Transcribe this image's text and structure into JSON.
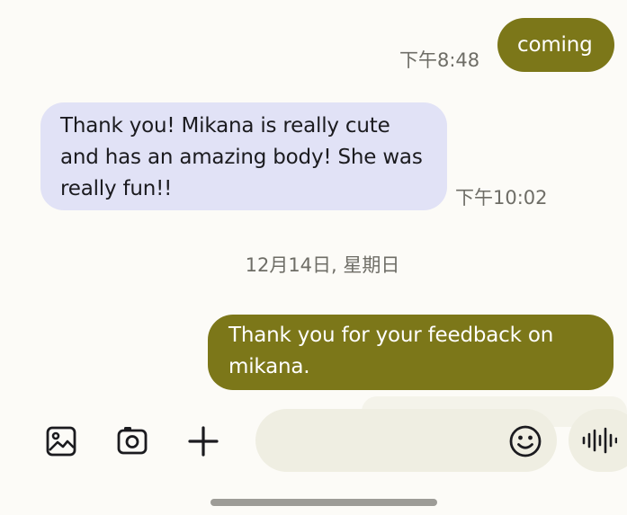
{
  "conversation": {
    "messages": [
      {
        "direction": "sent",
        "text": "coming",
        "time": "下午8:48"
      },
      {
        "direction": "received",
        "text": "Thank you! Mikana is really cute and has an amazing body! She was really fun!!",
        "time": "下午10:02"
      },
      {
        "direction": "sent",
        "text": "Thank you for your feedback on mikana.",
        "time": ""
      }
    ],
    "date_separator": "12月14日, 星期日"
  },
  "composer": {
    "input_value": "",
    "buttons": [
      "gallery-icon",
      "camera-icon",
      "plus-icon",
      "emoji-icon",
      "voice-waveform-icon"
    ]
  },
  "colors": {
    "sent_bubble": "#7c7719",
    "received_bubble": "#e1e2f6",
    "background": "#fcfbf7",
    "composer_pill": "#efeee2"
  }
}
